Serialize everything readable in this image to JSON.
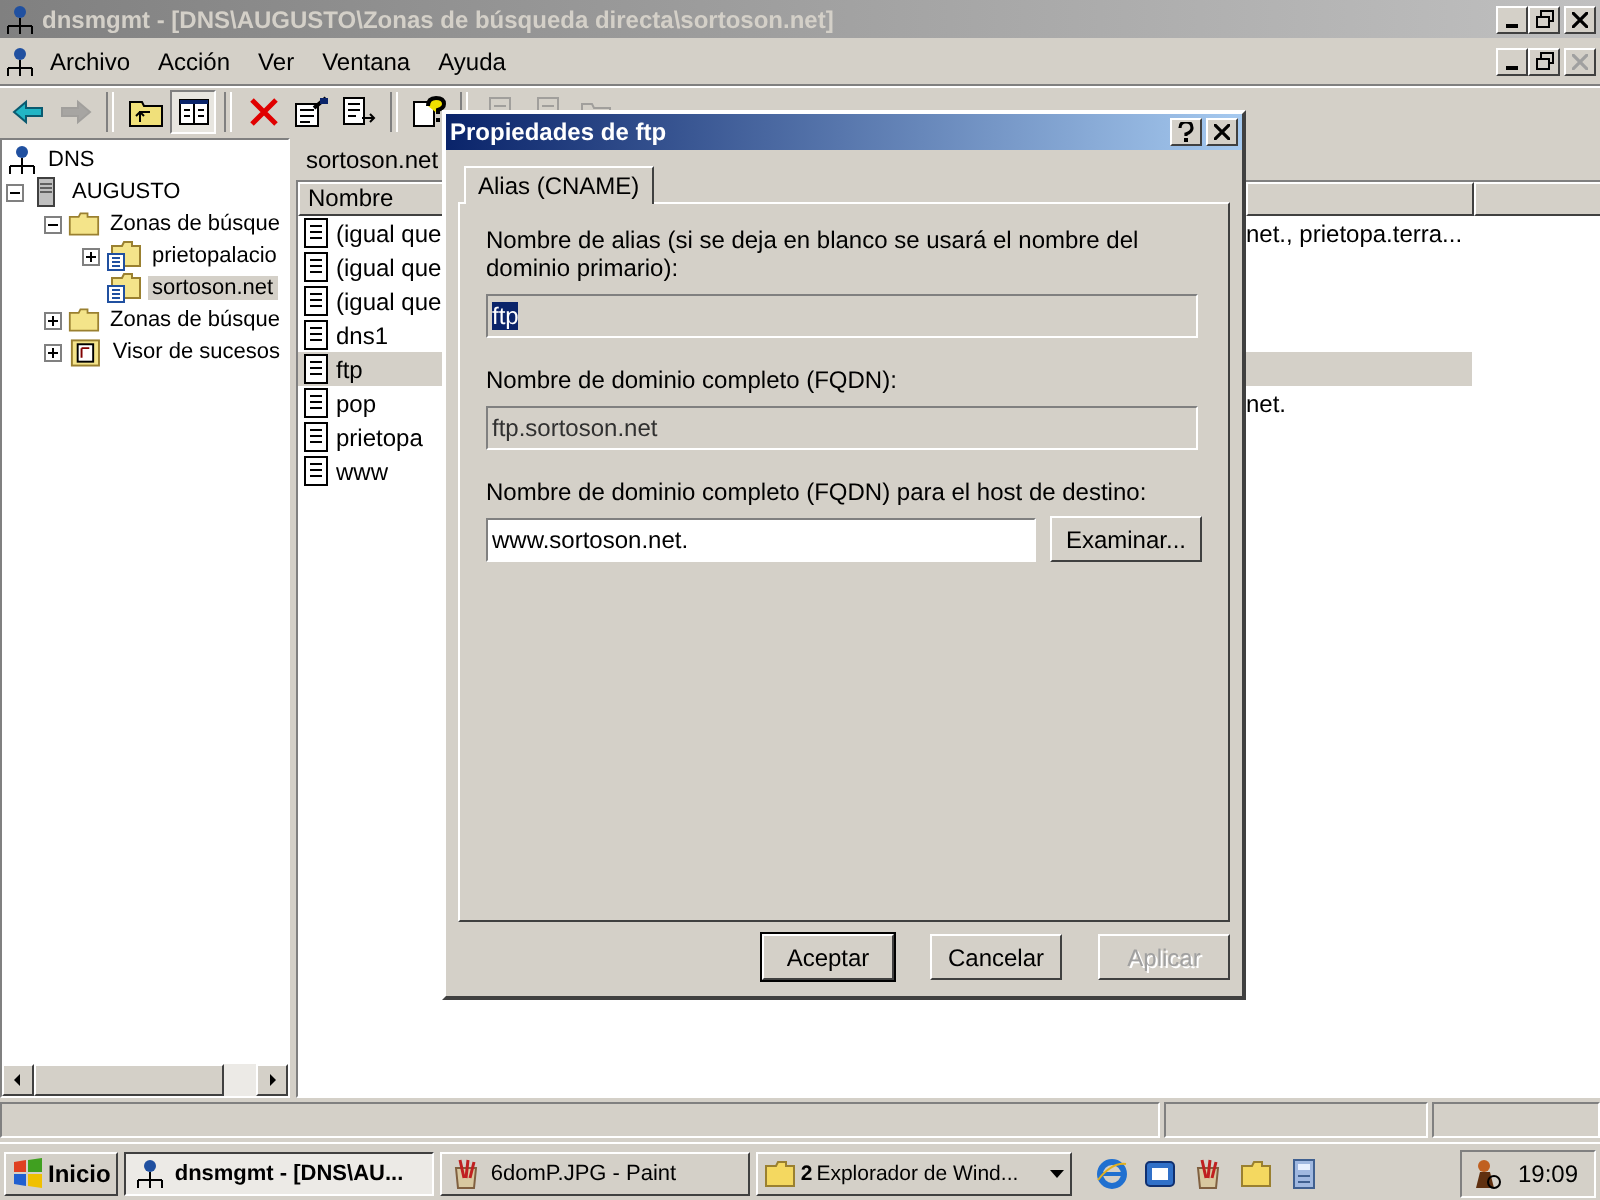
{
  "window": {
    "title": "dnsmgmt - [DNS\\AUGUSTO\\Zonas de búsqueda directa\\sortoson.net]",
    "active": false
  },
  "menu": [
    "Archivo",
    "Acción",
    "Ver",
    "Ventana",
    "Ayuda"
  ],
  "toolbar": [
    {
      "kind": "back",
      "disabled": false
    },
    {
      "kind": "forward",
      "disabled": true
    },
    {
      "kind": "separator"
    },
    {
      "kind": "up",
      "disabled": false
    },
    {
      "kind": "tree",
      "disabled": false,
      "on": true
    },
    {
      "kind": "separator"
    },
    {
      "kind": "delete",
      "disabled": false
    },
    {
      "kind": "properties",
      "disabled": false
    },
    {
      "kind": "export",
      "disabled": false
    },
    {
      "kind": "separator"
    },
    {
      "kind": "help",
      "disabled": false
    },
    {
      "kind": "separator"
    },
    {
      "kind": "record",
      "disabled": true
    },
    {
      "kind": "record",
      "disabled": true
    },
    {
      "kind": "folder",
      "disabled": true
    }
  ],
  "tree": [
    {
      "label": "DNS",
      "kind": "dns",
      "selected": false,
      "children": [
        {
          "label": "AUGUSTO",
          "kind": "server",
          "expanded": true,
          "selected": false,
          "children": [
            {
              "label": "Zonas de búsque",
              "kind": "folder",
              "expanded": true,
              "selected": false,
              "children": [
                {
                  "label": "prietopalacio",
                  "kind": "zone",
                  "expanded": false,
                  "selected": false
                },
                {
                  "label": "sortoson.net",
                  "kind": "zone",
                  "selected": true
                }
              ]
            },
            {
              "label": "Zonas de búsque",
              "kind": "folder",
              "expanded": false,
              "selected": false
            },
            {
              "label": "Visor de sucesos",
              "kind": "log",
              "expanded": false,
              "selected": false
            }
          ]
        }
      ]
    }
  ],
  "pane_title": "sortoson.net",
  "list": {
    "columns": [
      "Nombre"
    ],
    "rows": [
      {
        "name": "(igual que",
        "column_2": "net., prietopa.terra...",
        "selected": false
      },
      {
        "name": "(igual que",
        "selected": false
      },
      {
        "name": "(igual que",
        "selected": false
      },
      {
        "name": "dns1",
        "selected": false
      },
      {
        "name": "ftp",
        "selected": true
      },
      {
        "name": "pop",
        "column_2": "net.",
        "selected": false
      },
      {
        "name": "prietopa",
        "selected": false
      },
      {
        "name": "www",
        "selected": false
      }
    ]
  },
  "dialog": {
    "title": "Propiedades de ftp",
    "active": true,
    "tabs": [
      {
        "label": "Alias (CNAME)",
        "selected": true
      }
    ],
    "alias_label": "Nombre de alias (si se deja en blanco se usará el nombre del dominio primario):",
    "alias_field": {
      "value": "ftp",
      "disabled": true,
      "value_selected": true
    },
    "fqdn_label": "Nombre de dominio completo (FQDN):",
    "fqdn_field": {
      "value": "ftp.sortoson.net",
      "disabled": true
    },
    "target_label": "Nombre de dominio completo (FQDN) para el host de destino:",
    "target_field": {
      "value": "www.sortoson.net.",
      "disabled": false
    },
    "browse_button": "Examinar...",
    "buttons": [
      {
        "label": "Aceptar",
        "default": true,
        "disabled": false
      },
      {
        "label": "Cancelar",
        "default": false,
        "disabled": false
      },
      {
        "label": "Aplicar",
        "default": false,
        "disabled": true
      }
    ]
  },
  "taskbar": {
    "start": "Inicio",
    "tasks": [
      {
        "label": "dnsmgmt - [DNS\\AU...",
        "kind": "mmc",
        "selected": true
      },
      {
        "label": "6domP.JPG - Paint",
        "kind": "paint",
        "selected": false
      },
      {
        "count": "2",
        "label": "Explorador de Wind...",
        "kind": "folder",
        "selected": false
      }
    ],
    "quick_launch": [
      {
        "kind": "browser"
      },
      {
        "kind": "outlook"
      },
      {
        "kind": "paint"
      },
      {
        "kind": "folder"
      },
      {
        "kind": "calculator"
      }
    ],
    "clock": "19:09"
  }
}
